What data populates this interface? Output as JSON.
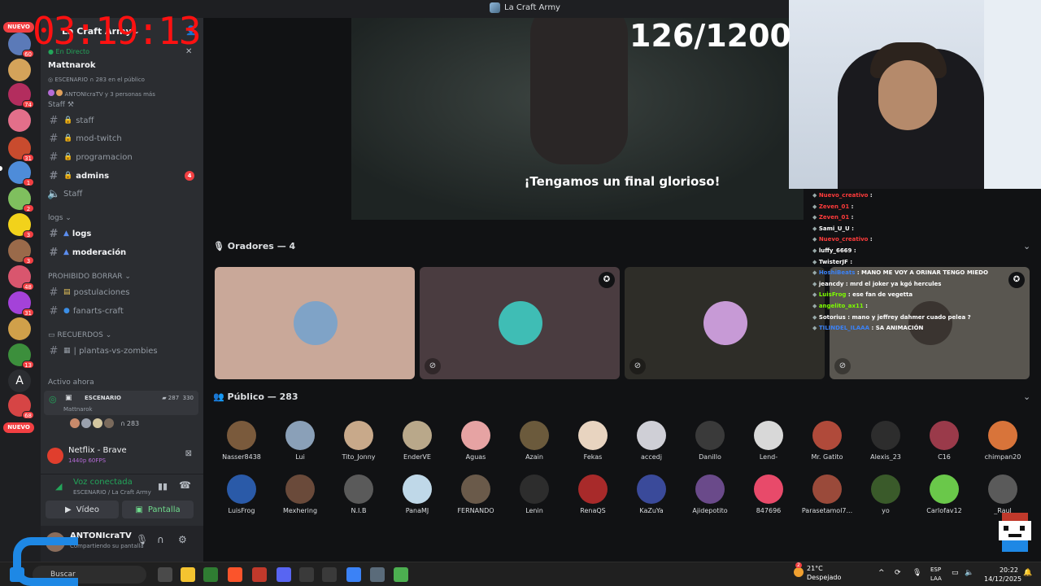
{
  "window": {
    "title": "La Craft Army"
  },
  "timer": {
    "text": "03:19:13"
  },
  "counter": {
    "text": "126/1200"
  },
  "server_rail": {
    "new_label_top": "NUEVO",
    "new_label_bottom": "NUEVO",
    "badges": [
      "60",
      "74",
      "31",
      "1",
      "2",
      "3",
      "3",
      "48",
      "31",
      "13",
      "68"
    ]
  },
  "sidebar": {
    "server_name": "La Craft Army",
    "live": {
      "status": "En Directo",
      "title": "Mattnarok",
      "stage_label": "ESCENARIO",
      "listeners": "283 en el público",
      "people": "ANTONIcraTV y 3 personas más"
    },
    "staff_category": "Staff",
    "channels_a": [
      {
        "name": "staff"
      },
      {
        "name": "mod-twitch"
      },
      {
        "name": "programacion"
      },
      {
        "name": "admins",
        "badge": "4"
      },
      {
        "name": "Staff"
      }
    ],
    "logs_category": "logs",
    "channels_b": [
      {
        "name": "logs"
      },
      {
        "name": "moderación"
      }
    ],
    "prohibido_category": "PROHIBIDO BORRAR",
    "channels_c": [
      {
        "name": "postulaciones"
      },
      {
        "name": "fanarts-craft"
      }
    ],
    "recuerdos_category": "RECUERDOS",
    "channels_d": [
      {
        "name": "| plantas-vs-zombies"
      }
    ],
    "active_now": "Activo ahora",
    "stage_card": {
      "name": "ESCENARIO",
      "host": "Mattnarok",
      "video_count": "287",
      "count": "330",
      "listeners": "283"
    }
  },
  "activity": {
    "title": "Netflix - Brave",
    "subtitle": "1440p 60FPS"
  },
  "voice": {
    "status": "Voz conectada",
    "location": "ESCENARIO / La Craft Army",
    "video_btn": "Vídeo",
    "screen_btn": "Pantalla"
  },
  "user": {
    "name": "ANTONIcraTV",
    "status": "Compartiendo su pantalla"
  },
  "stage": {
    "subtitle": "¡Tengamos un final glorioso!",
    "speakers_title": "Oradores — 4",
    "audience_title": "Público — 283"
  },
  "audience": [
    "Nasser8438",
    "Lui",
    "Tito_Jonny",
    "EnderVE",
    "Aguas",
    "Azain",
    "Fekas",
    "accedj",
    "Danillo",
    "Lend-",
    "Mr. Gatito",
    "Alexis_23",
    "C16",
    "chimpan20",
    "LuisFrog",
    "Mexhering",
    "N.I.B",
    "PanaMJ",
    "FERNANDO",
    "Lenin",
    "RenaQS",
    "KaZuYa",
    "Ajidepotito",
    "847696",
    "Parasetamol7...",
    "yo",
    "Carlofav12",
    "_Raul"
  ],
  "chat": [
    {
      "user": "Nuevo_creativo",
      "msg": ":",
      "color": "#ff3b3b"
    },
    {
      "user": "Zeven_01",
      "msg": ":",
      "color": "#ff3b3b"
    },
    {
      "user": "Zeven_01",
      "msg": ":",
      "color": "#ff3b3b"
    },
    {
      "user": "Sami_U_U",
      "msg": ":",
      "color": "#ffffff"
    },
    {
      "user": "Nuevo_creativo",
      "msg": ":",
      "color": "#ff3b3b"
    },
    {
      "user": "luffy_6669",
      "msg": ":",
      "color": "#ffffff"
    },
    {
      "user": "TwisterJF",
      "msg": ":",
      "color": "#ffffff"
    },
    {
      "user": "HoshiBeats",
      "msg": ": MANO ME VOY A ORINAR TENGO MIEDO",
      "color": "#3b82f6"
    },
    {
      "user": "jeancdy",
      "msg": ": mrd el joker ya kgó hercules",
      "color": "#ffffff"
    },
    {
      "user": "LuisFrog",
      "msg": ": ese fan de vegetta",
      "color": "#7cfc00"
    },
    {
      "user": "angelito_ax11",
      "msg": ":",
      "color": "#7cfc00"
    },
    {
      "user": "Sotorius",
      "msg": ": mano y jeffrey dahmer cuado pelea ?",
      "color": "#ffffff"
    },
    {
      "user": "TILINDEL_ILAAA",
      "msg": ": SA ANIMACIÓN",
      "color": "#3b82f6"
    }
  ],
  "taskbar": {
    "search": "Buscar",
    "weather_temp": "21°C",
    "weather_desc": "Despejado",
    "weather_badge": "2",
    "lang_top": "ESP",
    "lang_bottom": "LAA",
    "time": "20:22",
    "date": "14/12/2025"
  }
}
